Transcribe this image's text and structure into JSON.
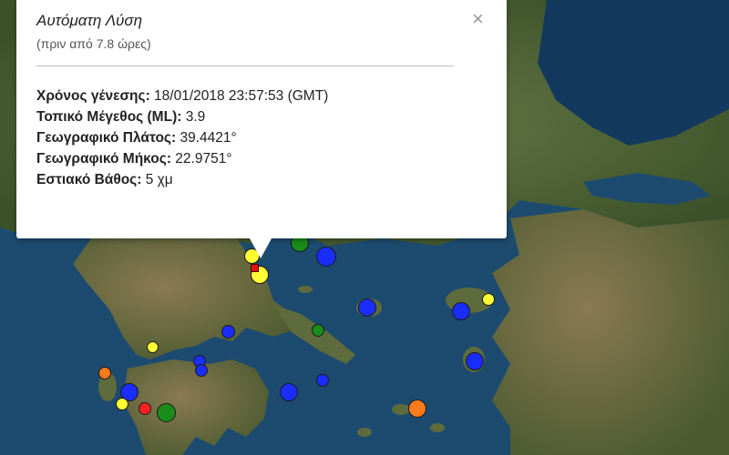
{
  "popup": {
    "title": "Αυτόματη Λύση",
    "subtitle": "(πριν από 7.8 ώρες)",
    "close_symbol": "×",
    "rows": [
      {
        "key": "Χρόνος γένεσης:",
        "value": " 18/01/2018  23:57:53 (GMT)"
      },
      {
        "key": "Τοπικό Μέγεθος (ML):",
        "value": " 3.9"
      },
      {
        "key": "Γεωγραφικό Πλάτος:",
        "value": " 39.4421°"
      },
      {
        "key": "Γεωγραφικό Μήκος:",
        "value": " 22.9751°"
      },
      {
        "key": "Εστιακό Βάθος:",
        "value": " 5 χμ"
      }
    ]
  },
  "colors": {
    "sea": "#1c4a6e",
    "land_dark": "#3d5a2a",
    "land_brown": "#7a6a45",
    "marker_yellow": "#ffff33",
    "marker_blue": "#1a2dff",
    "marker_green": "#1a8c1a",
    "marker_orange": "#ff7a1a",
    "marker_red": "#ff2020",
    "selected_epicenter": "#e01010"
  },
  "legend_meaning": "colored circles are earthquake events; the small red square marks the selected event"
}
